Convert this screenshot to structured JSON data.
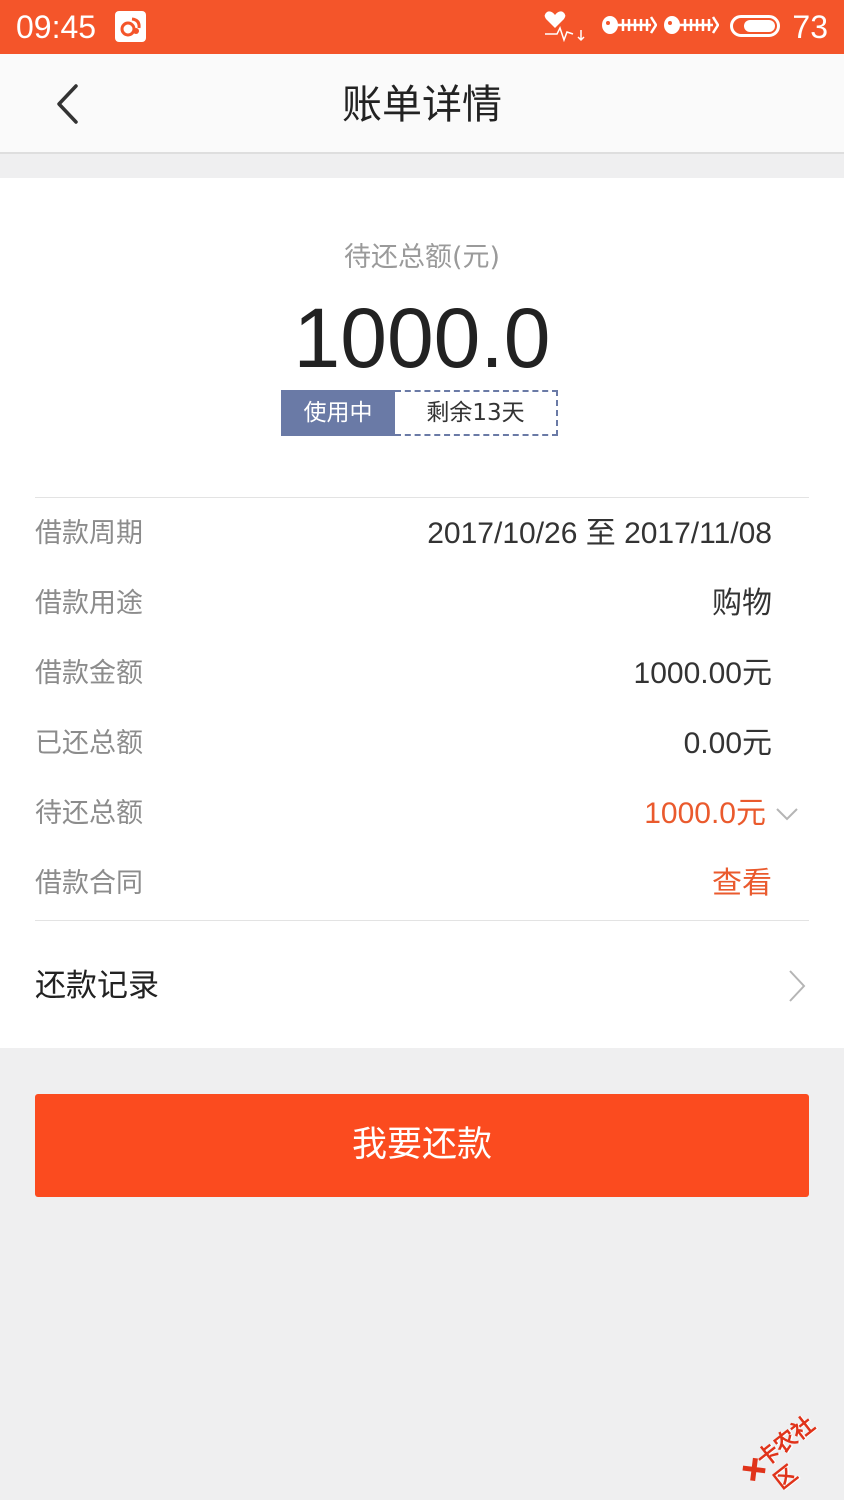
{
  "status_bar": {
    "time": "09:45",
    "battery": "73",
    "icons": [
      "app-notification-icon",
      "heart-signal-icon",
      "fishbone-icon",
      "fishbone-icon",
      "battery-icon"
    ]
  },
  "header": {
    "back_icon": "chevron-left-icon",
    "title": "账单详情"
  },
  "summary": {
    "amount_label": "待还总额(元)",
    "amount": "1000.0",
    "status": "使用中",
    "remaining": "剩余13天"
  },
  "details": [
    {
      "label": "借款周期",
      "value": "2017/10/26 至 2017/11/08"
    },
    {
      "label": "借款用途",
      "value": "购物"
    },
    {
      "label": "借款金额",
      "value": "1000.00元"
    },
    {
      "label": "已还总额",
      "value": "0.00元"
    },
    {
      "label": "待还总额",
      "value": "1000.0元"
    },
    {
      "label": "借款合同",
      "value": "查看"
    }
  ],
  "records": {
    "label": "还款记录"
  },
  "pay_button": {
    "label": "我要还款"
  },
  "watermark": {
    "text": "卡农社区"
  },
  "colors": {
    "accent": "#f4552a",
    "button": "#fb4b1f",
    "badge": "#6a7aa6",
    "highlight_text": "#ea5a2d"
  }
}
